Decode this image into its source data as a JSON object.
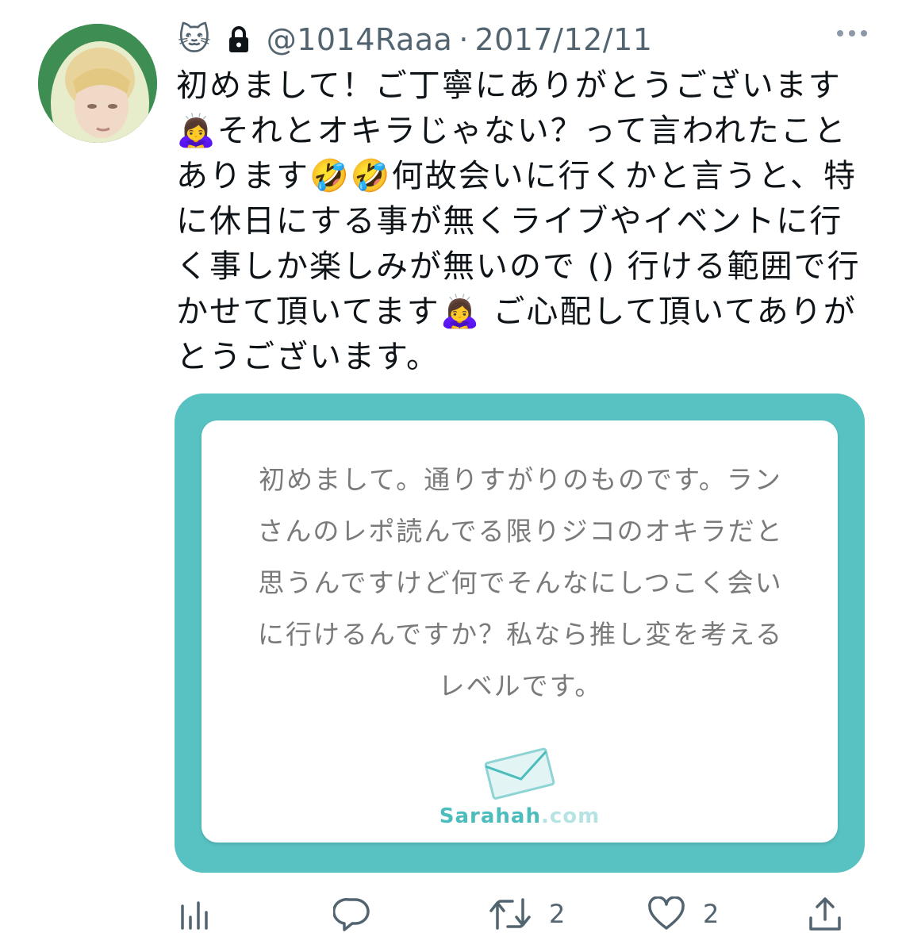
{
  "tweet": {
    "author_emoji": "🐱",
    "handle": "@1014Raaa",
    "separator": "·",
    "date": "2017/12/11",
    "text": "初めまして！ご丁寧にありがとうございます🙇‍♀️それとオキラじゃない？って言われたことあります🤣🤣何故会いに行くかと言うと、特に休日にする事が無くライブやイベントに行く事しか楽しみが無いので () 行ける範囲で行かせて頂いてます🙇‍♀️ ご心配して頂いてありがとうございます。"
  },
  "card": {
    "question": "初めまして。通りすがりのものです。ランさんのレポ読んでる限りジコのオキラだと思うんですけど何でそんなにしつこく会いに行けるんですか？私なら推し変を考えるレベルです。",
    "logo_brand": "Sarahah",
    "logo_tld": ".com",
    "accent_color": "#58c1c1"
  },
  "actions": {
    "retweet_count": "2",
    "like_count": "2"
  },
  "icons": {
    "lock": "lock-icon",
    "more": "more-icon",
    "analytics": "analytics-icon",
    "reply": "reply-icon",
    "retweet": "retweet-icon",
    "like": "heart-icon",
    "share": "share-icon",
    "envelope": "envelope-icon"
  }
}
